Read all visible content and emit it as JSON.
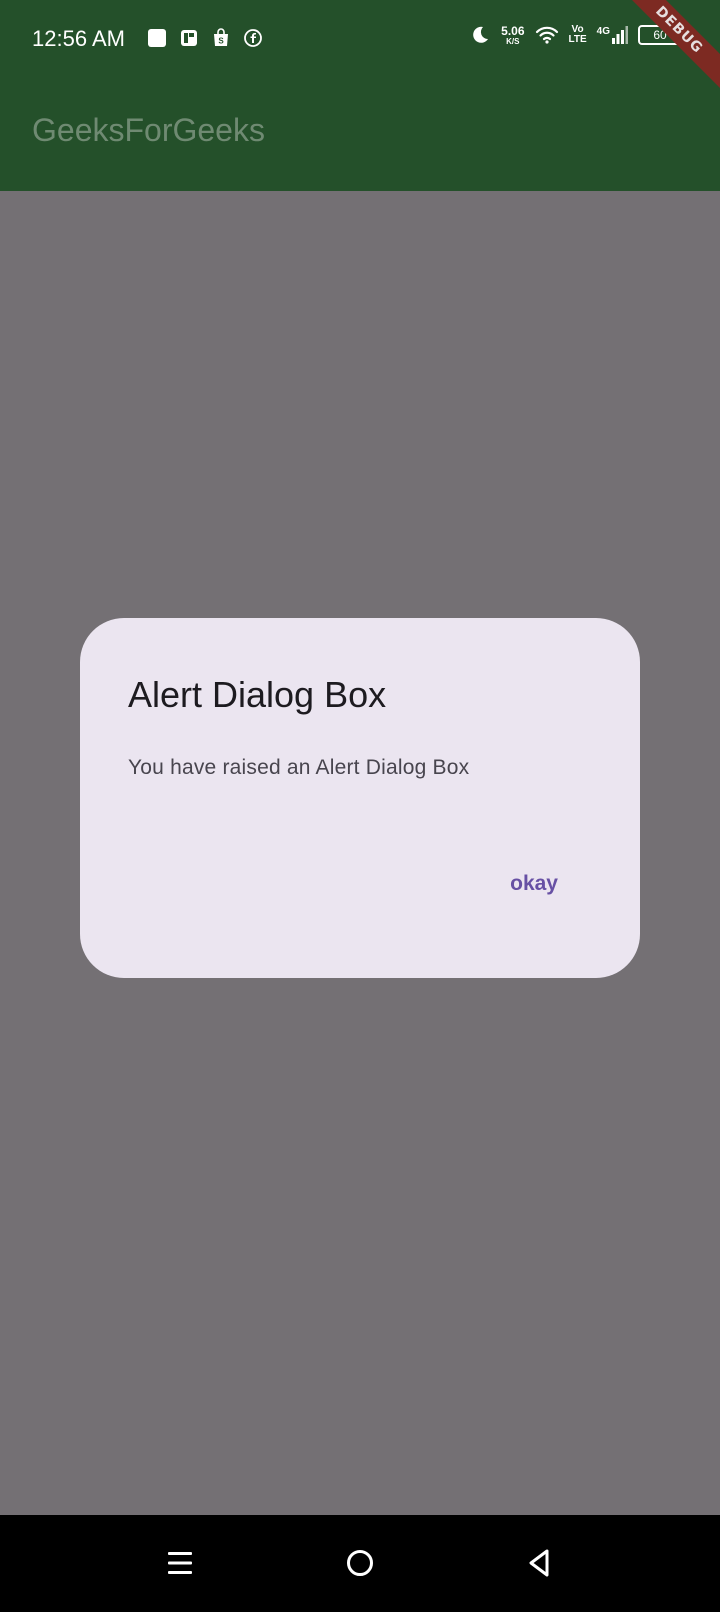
{
  "status_bar": {
    "time": "12:56 AM",
    "net_speed_value": "5.06",
    "net_speed_unit": "K/S",
    "volte_top": "Vo",
    "volte_bottom": "LTE",
    "network_type": "4G",
    "battery": "60",
    "notification_icons": [
      "square-icon",
      "pdf-app-icon",
      "shopping-bag-icon",
      "facebook-icon"
    ]
  },
  "app_bar": {
    "title": "GeeksForGeeks",
    "color": "#24502a"
  },
  "debug_banner": {
    "label": "DEBUG"
  },
  "dialog": {
    "title": "Alert Dialog Box",
    "content": "You have raised an Alert Dialog Box",
    "action_label": "okay",
    "accent_color": "#6750a4",
    "background": "#ebe5f0"
  },
  "scrim_color": "#747074",
  "nav_bar": {
    "buttons": [
      "menu-icon",
      "home-icon",
      "back-icon"
    ]
  }
}
